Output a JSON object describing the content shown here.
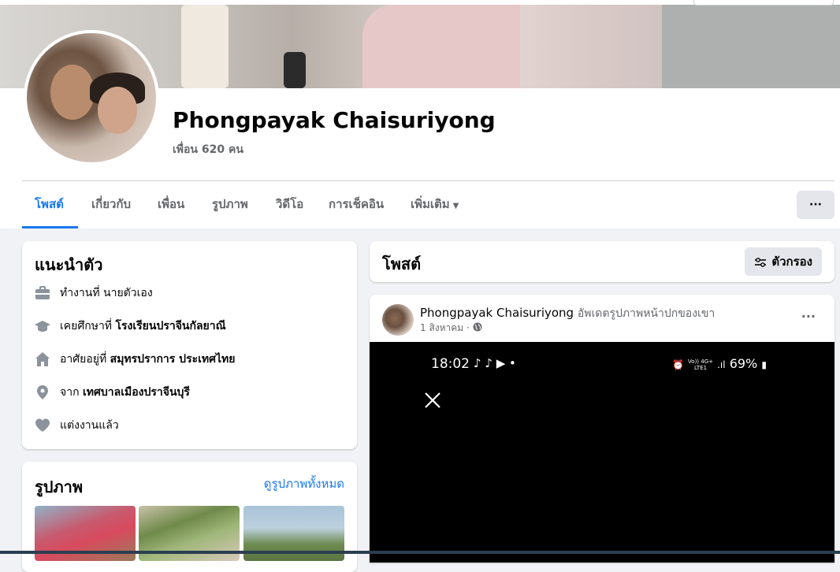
{
  "profile": {
    "name": "Phongpayak Chaisuriyong",
    "friends": "เพื่อน 620 คน"
  },
  "tabs": [
    {
      "label": "โพสต์",
      "active": true
    },
    {
      "label": "เกี่ยวกับ",
      "active": false
    },
    {
      "label": "เพื่อน",
      "active": false
    },
    {
      "label": "รูปภาพ",
      "active": false
    },
    {
      "label": "วิดีโอ",
      "active": false
    },
    {
      "label": "การเช็คอิน",
      "active": false
    },
    {
      "label": "เพิ่มเติม",
      "active": false
    }
  ],
  "more_button": "···",
  "intro": {
    "title": "แนะนำตัว",
    "items": [
      {
        "icon": "briefcase-icon",
        "prefix": "ทำงานที่ ",
        "value": "นายตัวเอง",
        "bold": false
      },
      {
        "icon": "graduation-cap-icon",
        "prefix": "เคยศึกษาที่ ",
        "value": "โรงเรียนปราจีนกัลยาณี",
        "bold": true
      },
      {
        "icon": "home-icon",
        "prefix": "อาศัยอยู่ที่ ",
        "value": "สมุทรปราการ ประเทศไทย",
        "bold": true
      },
      {
        "icon": "location-pin-icon",
        "prefix": "จาก ",
        "value": "เทศบาลเมืองปราจีนบุรี",
        "bold": true
      },
      {
        "icon": "heart-icon",
        "prefix": "",
        "value": "แต่งงานแล้ว",
        "bold": false
      }
    ]
  },
  "photos": {
    "title": "รูปภาพ",
    "see_all": "ดูรูปภาพทั้งหมด"
  },
  "posts": {
    "title": "โพสต์",
    "filter_label": "ตัวกรอง"
  },
  "post": {
    "author": "Phongpayak Chaisuriyong",
    "action": "อัพเดตรูปภาพหน้าปกของเขา",
    "date": "1 สิงหาคม · ",
    "more": "···",
    "screen": {
      "time": "18:02",
      "battery": "69%",
      "network_top": "Vo)) 4G+",
      "network_bottom": "LTE1"
    }
  },
  "colors": {
    "accent": "#1877f2",
    "secondary_text": "#65676b",
    "page_bg": "#f0f2f5"
  }
}
